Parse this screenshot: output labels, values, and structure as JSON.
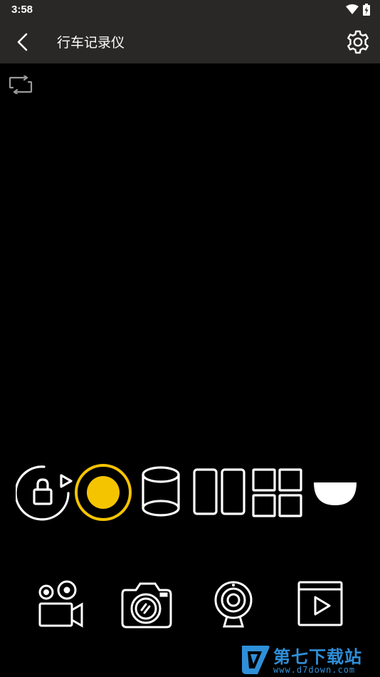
{
  "status_bar": {
    "time": "3:58",
    "icons": [
      "wifi-icon",
      "battery-charging-icon"
    ]
  },
  "toolbar": {
    "title": "行车记录仪",
    "back_icon": "chevron-left-icon",
    "settings_icon": "gear-icon"
  },
  "preview": {
    "rotate_icon": "rotate-screen-icon"
  },
  "controls": {
    "items": [
      "lock-rotate-icon",
      "record-icon",
      "cylinder-view-icon",
      "dual-view-icon",
      "quad-view-icon",
      "dome-view-icon"
    ],
    "accent_color": "#f5c400"
  },
  "bottom_bar": {
    "items": [
      "video-camera-icon",
      "photo-camera-icon",
      "webcam-icon",
      "video-gallery-icon"
    ]
  },
  "watermark": {
    "title": "第七下载站",
    "url": "www.d7down.com",
    "color": "#2f8fd8"
  }
}
